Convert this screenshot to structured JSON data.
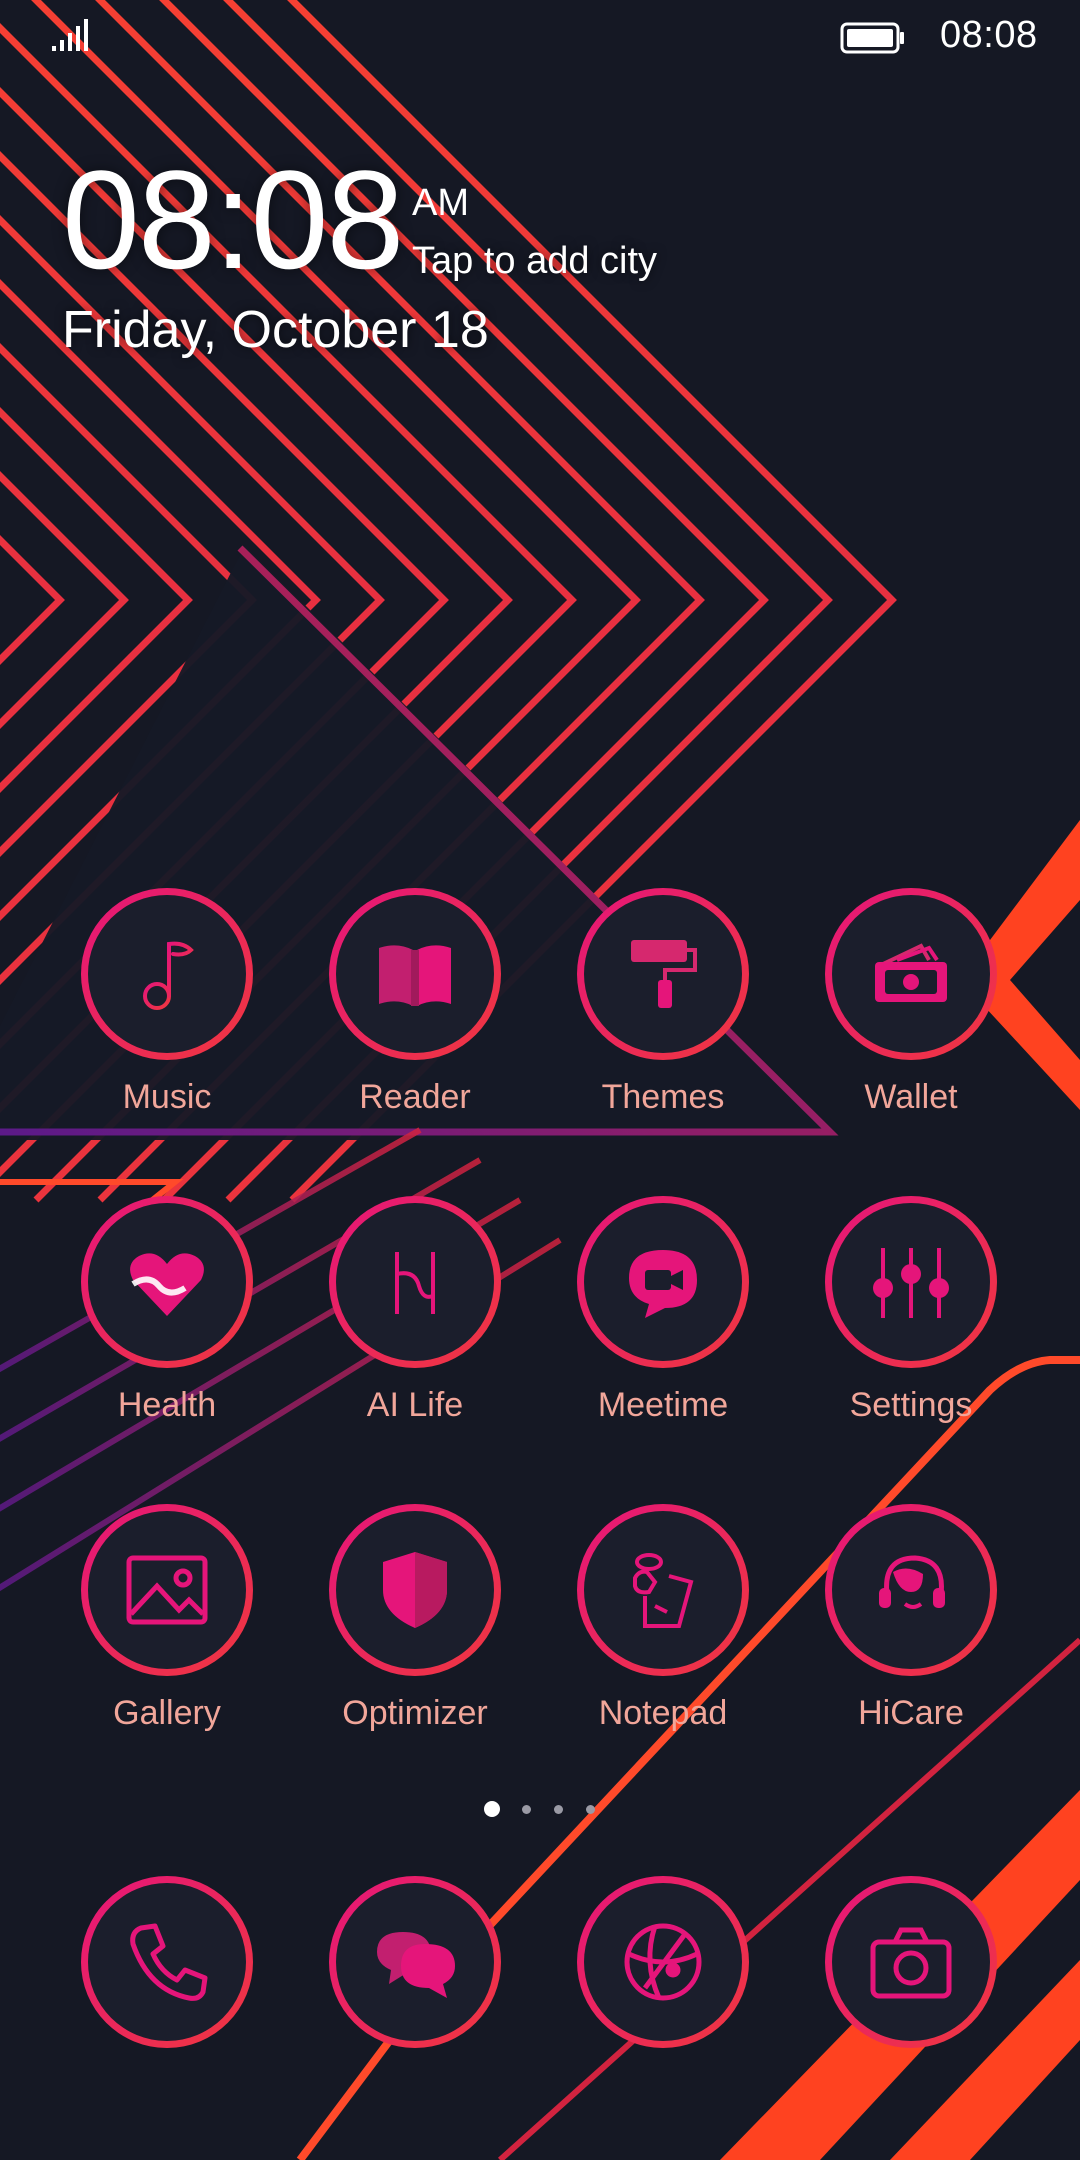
{
  "status_bar": {
    "time": "08:08",
    "signal_icon": "signal-icon",
    "battery_icon": "battery-icon"
  },
  "clock": {
    "time": "08:08",
    "ampm": "AM",
    "city": "Tap to add city",
    "date": "Friday, October 18"
  },
  "apps": [
    {
      "label": "Music",
      "icon": "music-note-icon"
    },
    {
      "label": "Reader",
      "icon": "book-icon"
    },
    {
      "label": "Themes",
      "icon": "paint-roller-icon"
    },
    {
      "label": "Wallet",
      "icon": "wallet-icon"
    },
    {
      "label": "Health",
      "icon": "heart-icon"
    },
    {
      "label": "AI Life",
      "icon": "ai-life-icon"
    },
    {
      "label": "Meetime",
      "icon": "video-chat-icon"
    },
    {
      "label": "Settings",
      "icon": "sliders-icon"
    },
    {
      "label": "Gallery",
      "icon": "image-icon"
    },
    {
      "label": "Optimizer",
      "icon": "shield-icon"
    },
    {
      "label": "Notepad",
      "icon": "notepad-icon"
    },
    {
      "label": "HiCare",
      "icon": "support-agent-icon"
    }
  ],
  "dock": [
    {
      "icon": "phone-icon"
    },
    {
      "icon": "messages-icon"
    },
    {
      "icon": "browser-icon"
    },
    {
      "icon": "camera-icon"
    }
  ],
  "page_indicator": {
    "count": 4,
    "active": 1
  },
  "colors": {
    "background": "#151824",
    "accent_pink": "#e5157a",
    "accent_red": "#f0383e",
    "label": "#f1a69a"
  }
}
